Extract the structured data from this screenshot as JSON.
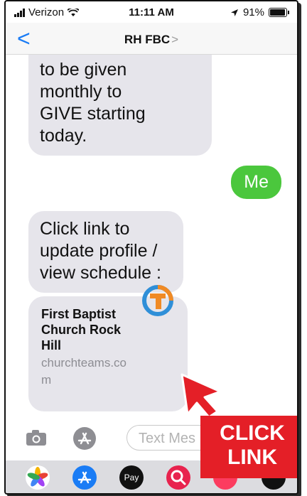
{
  "status": {
    "carrier": "Verizon",
    "time": "11:11 AM",
    "battery": "91%"
  },
  "nav": {
    "back_icon": "<",
    "title": "RH FBC",
    "chevron": ">"
  },
  "messages": {
    "first": [
      "to be given",
      "monthly to",
      "GIVE starting",
      "today."
    ],
    "sent": "Me",
    "second": [
      "Click link to",
      "update profile /",
      "view schedule :"
    ]
  },
  "link_card": {
    "title": [
      "First Baptist",
      "Church Rock",
      "Hill"
    ],
    "domain": [
      "churchteams.co",
      "m"
    ]
  },
  "input": {
    "placeholder": "Text Mes"
  },
  "overlay": {
    "line1": "CLICK",
    "line2": "LINK"
  },
  "dock": {
    "apple_pay_label": "Pay"
  },
  "colors": {
    "ios_blue": "#1a7cf5",
    "sent_green": "#4bc73d",
    "overlay_red": "#e41f27",
    "bubble_gray": "#e6e5eb"
  }
}
